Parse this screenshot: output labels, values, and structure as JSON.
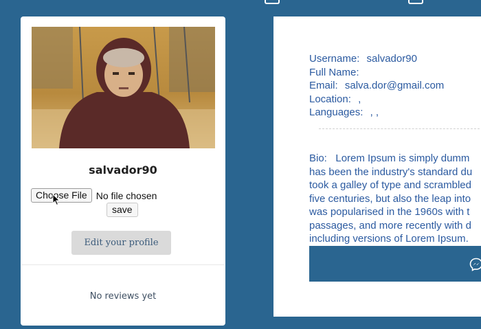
{
  "top_icons": [
    "window-icon",
    "window-icon"
  ],
  "profile": {
    "username": "salvador90",
    "file_input": {
      "button_label": "Choose File",
      "status": "No file chosen"
    },
    "save_label": "save",
    "edit_label": "Edit your profile",
    "reviews_text": "No reviews yet"
  },
  "details": {
    "username_label": "Username:",
    "username_value": "salvador90",
    "fullname_label": "Full Name:",
    "fullname_value": "",
    "email_label": "Email:",
    "email_value": "salva.dor@gmail.com",
    "location_label": "Location:",
    "location_value": ",",
    "languages_label": "Languages:",
    "languages_value": ", ,"
  },
  "bio": {
    "label": "Bio:",
    "lines": [
      "Lorem Ipsum is simply dumm",
      "has been the industry's standard du",
      "took a galley of type and scrambled",
      "five centuries, but also the leap into",
      "was popularised in the 1960s with t",
      "passages, and more recently with d",
      "including versions of Lorem Ipsum."
    ]
  },
  "message_button_icon": "messenger-icon",
  "colors": {
    "background": "#2a6590",
    "text_blue": "#2b5aa0"
  }
}
